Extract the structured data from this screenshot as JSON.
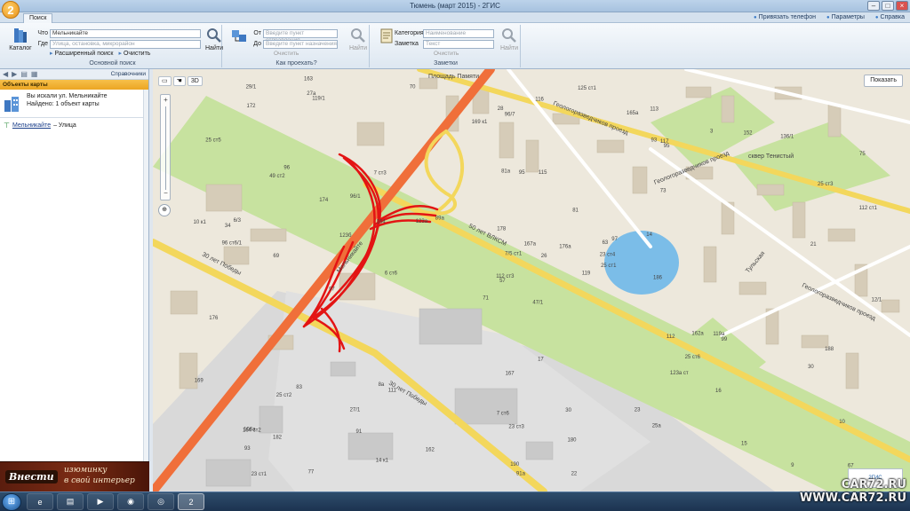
{
  "window": {
    "logo": "2",
    "title": "Тюмень (март 2015) - 2ГИС",
    "buttons": [
      "–",
      "□",
      "×"
    ]
  },
  "tabs": {
    "search": "Поиск"
  },
  "top_links": {
    "phone": "Привязать телефон",
    "params": "Параметры",
    "help": "Справка"
  },
  "ribbon": {
    "catalog_label": "Каталог",
    "what_label": "Что",
    "what_value": "Мельникайте",
    "where_label": "Где",
    "where_placeholder": "Улица, остановка, микрорайон",
    "find_label": "Найти",
    "advanced_search": "Расширенный поиск",
    "clear": "Очистить",
    "group1": "Основной поиск",
    "from_label": "От",
    "from_placeholder": "Введите пункт отправления",
    "to_label": "До",
    "to_placeholder": "Введите пункт назначения",
    "route_clear": "Очистить",
    "route_find": "Найти",
    "group2": "Как проехать?",
    "category_label": "Категория",
    "category_placeholder": "Наименование",
    "note_label": "Заметка",
    "note_placeholder": "Текст",
    "note_clear": "Очистить",
    "note_find": "Найти",
    "group3": "Заметки"
  },
  "left_panel": {
    "toolbar_right": "Справочники",
    "header": "Объекты карты",
    "result_line1": "Вы искали ул. Мельникайте",
    "result_line2": "Найдено: 1 объект карты",
    "street_name": "Мельникайте",
    "street_type": " – Улица"
  },
  "ad": {
    "brand": "Внести",
    "line1": "изюминку",
    "line2": "в свой интерьер"
  },
  "map": {
    "mode_3d": "3D",
    "show_button": "Показать",
    "corner_label": "2ГИС",
    "street_labels": {
      "melnikaite": "Мельникайте",
      "vlksm": "50 лет ВЛКСМ",
      "pobedy1": "30 лет Победы",
      "pobedy2": "30 лет Победы",
      "geolog1": "Геологоразведчиков проезд",
      "geolog2": "Геологоразведчиков проезд",
      "geolog3": "Геологоразведчиков проезд",
      "tulskaya": "Тульская",
      "square_pamyati": "Площадь Памяти",
      "tenistyi": "сквер Тенистый"
    },
    "house_numbers": [
      "47/1",
      "49 ст2",
      "57",
      "106а",
      "63",
      "111",
      "113",
      "115",
      "117",
      "119",
      "119/1",
      "67",
      "69",
      "75",
      "71",
      "73",
      "77",
      "81а",
      "81",
      "83",
      "89а",
      "93",
      "91",
      "95",
      "97",
      "99",
      "96",
      "96/7",
      "96 ст6/1",
      "112",
      "112 ст1",
      "112 ст3",
      "7 ст6",
      "7/5 ст1",
      "7 ст3",
      "3",
      "8а",
      "9",
      "10",
      "119а",
      "125 ст1",
      "123а",
      "123б",
      "123а ст",
      "14 к1",
      "10 к1",
      "23 ст4",
      "23 ст1",
      "23 ст3",
      "25 ст1",
      "25 ст2",
      "25 ст3",
      "25 ст5",
      "25 ст6",
      "25а",
      "27/1",
      "27а",
      "29/1",
      "30",
      "136/1",
      "116",
      "6 ст6",
      "6/3",
      "96/1",
      "152",
      "163",
      "165а",
      "169 к1",
      "167а",
      "169",
      "167",
      "162",
      "162а",
      "164",
      "164 ст2",
      "172",
      "174",
      "176",
      "178",
      "180",
      "176а",
      "182",
      "186",
      "188",
      "190",
      "21",
      "17",
      "15",
      "22",
      "23",
      "28",
      "12/1",
      "14",
      "16",
      "26",
      "30",
      "34",
      "91а",
      "93",
      "95",
      "97",
      "70"
    ]
  },
  "watermark": {
    "line1": "CAR72.RU",
    "line2": "WWW.CAR72.RU"
  }
}
